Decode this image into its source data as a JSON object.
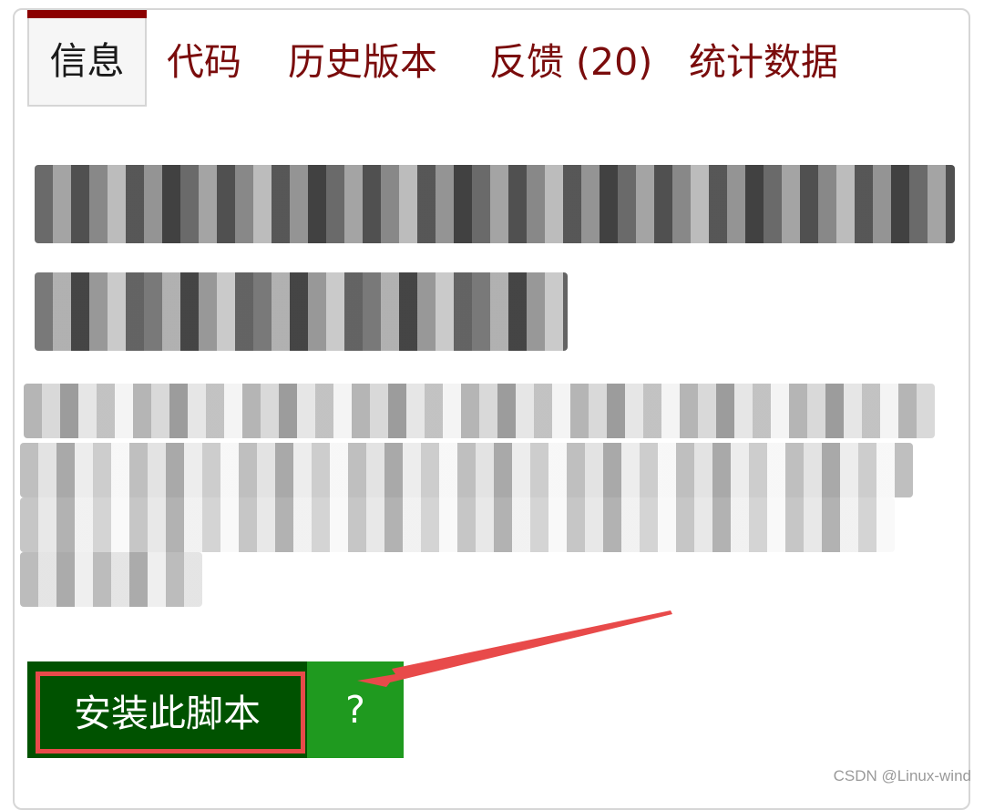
{
  "tabs": {
    "info": "信息",
    "code": "代码",
    "history": "历史版本",
    "feedback": "反馈 (20)",
    "stats": "统计数据"
  },
  "install": {
    "label": "安装此脚本",
    "help": "?"
  },
  "watermark": "CSDN @Linux-wind",
  "colors": {
    "tab_text": "#7a0c0c",
    "active_tab_accent": "#8b0000",
    "install_bg": "#005200",
    "help_bg": "#1f9a1f",
    "annotation": "#e84a4a"
  }
}
